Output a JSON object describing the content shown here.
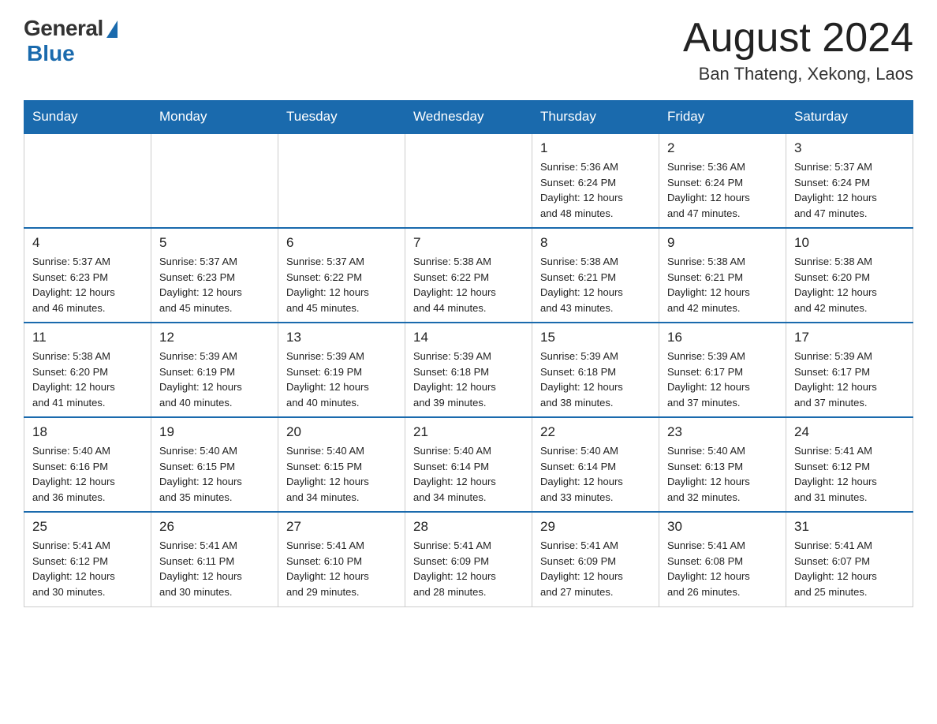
{
  "header": {
    "logo_general": "General",
    "logo_blue": "Blue",
    "month_title": "August 2024",
    "location": "Ban Thateng, Xekong, Laos"
  },
  "days_of_week": [
    "Sunday",
    "Monday",
    "Tuesday",
    "Wednesday",
    "Thursday",
    "Friday",
    "Saturday"
  ],
  "weeks": [
    [
      {
        "day": "",
        "info": ""
      },
      {
        "day": "",
        "info": ""
      },
      {
        "day": "",
        "info": ""
      },
      {
        "day": "",
        "info": ""
      },
      {
        "day": "1",
        "info": "Sunrise: 5:36 AM\nSunset: 6:24 PM\nDaylight: 12 hours\nand 48 minutes."
      },
      {
        "day": "2",
        "info": "Sunrise: 5:36 AM\nSunset: 6:24 PM\nDaylight: 12 hours\nand 47 minutes."
      },
      {
        "day": "3",
        "info": "Sunrise: 5:37 AM\nSunset: 6:24 PM\nDaylight: 12 hours\nand 47 minutes."
      }
    ],
    [
      {
        "day": "4",
        "info": "Sunrise: 5:37 AM\nSunset: 6:23 PM\nDaylight: 12 hours\nand 46 minutes."
      },
      {
        "day": "5",
        "info": "Sunrise: 5:37 AM\nSunset: 6:23 PM\nDaylight: 12 hours\nand 45 minutes."
      },
      {
        "day": "6",
        "info": "Sunrise: 5:37 AM\nSunset: 6:22 PM\nDaylight: 12 hours\nand 45 minutes."
      },
      {
        "day": "7",
        "info": "Sunrise: 5:38 AM\nSunset: 6:22 PM\nDaylight: 12 hours\nand 44 minutes."
      },
      {
        "day": "8",
        "info": "Sunrise: 5:38 AM\nSunset: 6:21 PM\nDaylight: 12 hours\nand 43 minutes."
      },
      {
        "day": "9",
        "info": "Sunrise: 5:38 AM\nSunset: 6:21 PM\nDaylight: 12 hours\nand 42 minutes."
      },
      {
        "day": "10",
        "info": "Sunrise: 5:38 AM\nSunset: 6:20 PM\nDaylight: 12 hours\nand 42 minutes."
      }
    ],
    [
      {
        "day": "11",
        "info": "Sunrise: 5:38 AM\nSunset: 6:20 PM\nDaylight: 12 hours\nand 41 minutes."
      },
      {
        "day": "12",
        "info": "Sunrise: 5:39 AM\nSunset: 6:19 PM\nDaylight: 12 hours\nand 40 minutes."
      },
      {
        "day": "13",
        "info": "Sunrise: 5:39 AM\nSunset: 6:19 PM\nDaylight: 12 hours\nand 40 minutes."
      },
      {
        "day": "14",
        "info": "Sunrise: 5:39 AM\nSunset: 6:18 PM\nDaylight: 12 hours\nand 39 minutes."
      },
      {
        "day": "15",
        "info": "Sunrise: 5:39 AM\nSunset: 6:18 PM\nDaylight: 12 hours\nand 38 minutes."
      },
      {
        "day": "16",
        "info": "Sunrise: 5:39 AM\nSunset: 6:17 PM\nDaylight: 12 hours\nand 37 minutes."
      },
      {
        "day": "17",
        "info": "Sunrise: 5:39 AM\nSunset: 6:17 PM\nDaylight: 12 hours\nand 37 minutes."
      }
    ],
    [
      {
        "day": "18",
        "info": "Sunrise: 5:40 AM\nSunset: 6:16 PM\nDaylight: 12 hours\nand 36 minutes."
      },
      {
        "day": "19",
        "info": "Sunrise: 5:40 AM\nSunset: 6:15 PM\nDaylight: 12 hours\nand 35 minutes."
      },
      {
        "day": "20",
        "info": "Sunrise: 5:40 AM\nSunset: 6:15 PM\nDaylight: 12 hours\nand 34 minutes."
      },
      {
        "day": "21",
        "info": "Sunrise: 5:40 AM\nSunset: 6:14 PM\nDaylight: 12 hours\nand 34 minutes."
      },
      {
        "day": "22",
        "info": "Sunrise: 5:40 AM\nSunset: 6:14 PM\nDaylight: 12 hours\nand 33 minutes."
      },
      {
        "day": "23",
        "info": "Sunrise: 5:40 AM\nSunset: 6:13 PM\nDaylight: 12 hours\nand 32 minutes."
      },
      {
        "day": "24",
        "info": "Sunrise: 5:41 AM\nSunset: 6:12 PM\nDaylight: 12 hours\nand 31 minutes."
      }
    ],
    [
      {
        "day": "25",
        "info": "Sunrise: 5:41 AM\nSunset: 6:12 PM\nDaylight: 12 hours\nand 30 minutes."
      },
      {
        "day": "26",
        "info": "Sunrise: 5:41 AM\nSunset: 6:11 PM\nDaylight: 12 hours\nand 30 minutes."
      },
      {
        "day": "27",
        "info": "Sunrise: 5:41 AM\nSunset: 6:10 PM\nDaylight: 12 hours\nand 29 minutes."
      },
      {
        "day": "28",
        "info": "Sunrise: 5:41 AM\nSunset: 6:09 PM\nDaylight: 12 hours\nand 28 minutes."
      },
      {
        "day": "29",
        "info": "Sunrise: 5:41 AM\nSunset: 6:09 PM\nDaylight: 12 hours\nand 27 minutes."
      },
      {
        "day": "30",
        "info": "Sunrise: 5:41 AM\nSunset: 6:08 PM\nDaylight: 12 hours\nand 26 minutes."
      },
      {
        "day": "31",
        "info": "Sunrise: 5:41 AM\nSunset: 6:07 PM\nDaylight: 12 hours\nand 25 minutes."
      }
    ]
  ]
}
